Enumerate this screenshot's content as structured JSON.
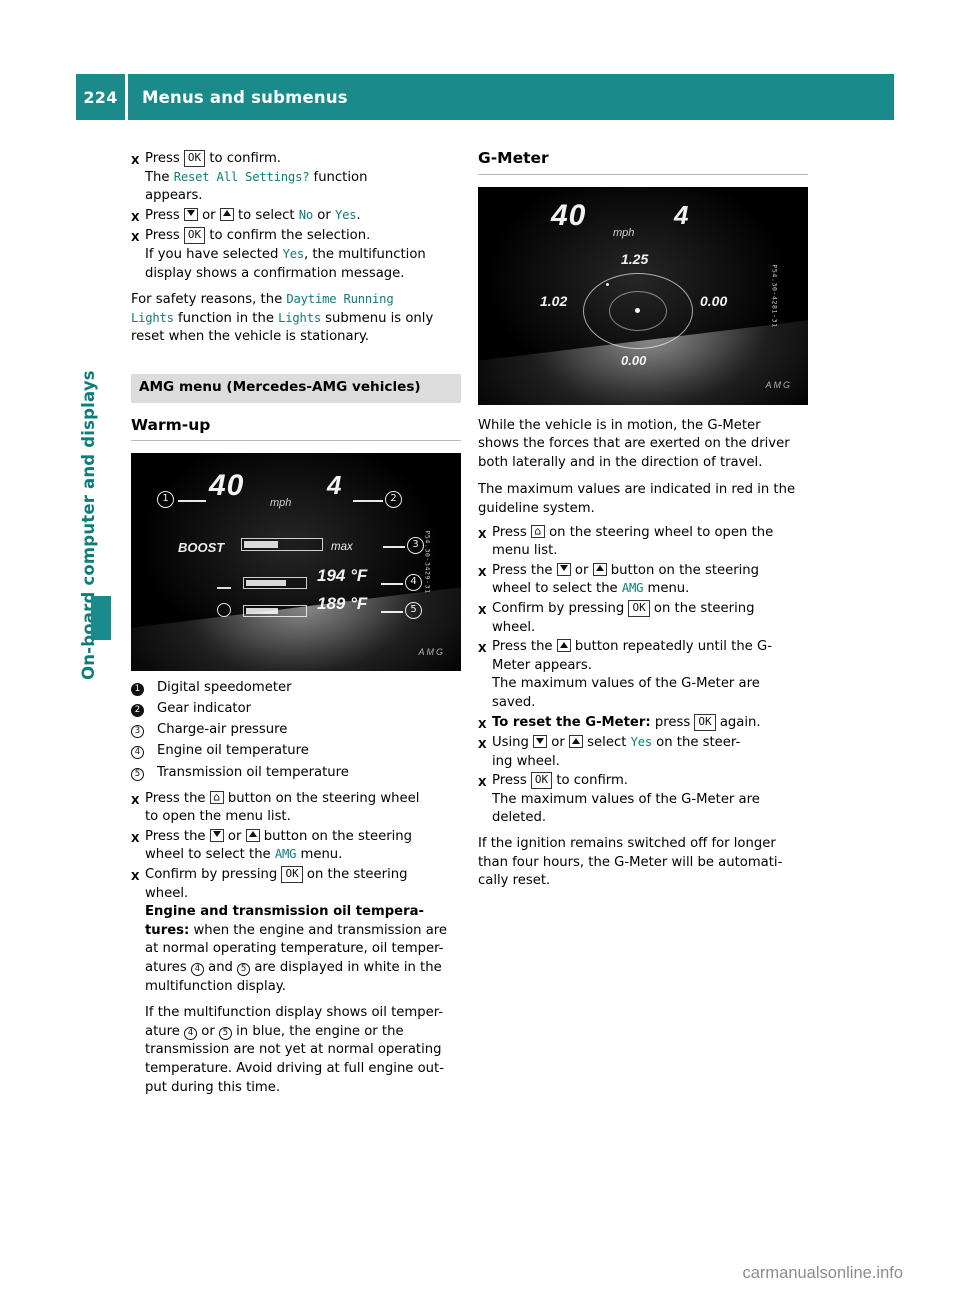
{
  "header": {
    "page_number": "224",
    "title": "Menus and submenus",
    "accent_color": "#1b8a8a"
  },
  "sidebar": {
    "chapter_label": "On-board computer and displays"
  },
  "left_column": {
    "steps": [
      {
        "pre": "Press ",
        "key": "OK",
        "post": " to confirm."
      },
      {
        "pre": "Press ",
        "key": "",
        "post": ""
      }
    ],
    "block1": {
      "line1_pre": "Press ",
      "line1_key": "OK",
      "line1_post": " to confirm.",
      "line2_pre": "The ",
      "line2_mono": "Reset All Settings?",
      "line2_post": " function",
      "line3": "appears."
    },
    "block2": {
      "pre": "Press ",
      "mid": " or ",
      "post": " to select ",
      "option_no": "No",
      "or": " or ",
      "option_yes": "Yes",
      "end": "."
    },
    "block3": {
      "line1_pre": "Press ",
      "line1_key": "OK",
      "line1_post": " to confirm the selection.",
      "line2_pre": "If you have selected ",
      "line2_mono": "Yes",
      "line2_post": ", the multifunction",
      "line3": "display shows a confirmation message."
    },
    "safety_note": {
      "pre": "For safety reasons, the ",
      "mono1": "Daytime Running",
      "mono1b": "Lights",
      "mid": " function in the ",
      "mono2": "Lights",
      "post": " submenu is only",
      "last": "reset when the vehicle is stationary."
    },
    "section_heading": "AMG menu (Mercedes-AMG vehicles)",
    "subheading": "Warm-up",
    "warmup_display": {
      "speed": "40",
      "speed_unit": "mph",
      "gear": "4",
      "boost_label": "BOOST",
      "max_label": "max",
      "engine_oil_temp": "194 °F",
      "transmission_oil_temp": "189 °F",
      "callouts": [
        "1",
        "2",
        "3",
        "4",
        "5"
      ],
      "watermark": "AMG",
      "side_code": "P54.30-3429-31"
    },
    "legend": [
      {
        "key": "1",
        "text": "Digital speedometer"
      },
      {
        "key": "2",
        "text": "Gear indicator"
      },
      {
        "key": "3",
        "text": "Charge-air pressure"
      },
      {
        "key": "4",
        "text": "Engine oil temperature"
      },
      {
        "key": "5",
        "text": "Transmission oil temperature"
      }
    ],
    "steps_after": {
      "s1_a": "Press the ",
      "s1_b": " button on the steering wheel",
      "s1_c": "to open the menu list.",
      "s2_a": "Press the ",
      "s2_or": " or ",
      "s2_b": " button on the steering",
      "s2_c": "wheel to select the ",
      "s2_mono": "AMG",
      "s2_d": " menu.",
      "s3_a": "Confirm by pressing ",
      "s3_key": "OK",
      "s3_b": " on the steering",
      "s3_c": "wheel.",
      "bold1": "Engine and transmission oil tempera-",
      "bold2": "tures:",
      "t1": " when the engine and transmission are",
      "t2": "at normal operating temperature, oil temper-",
      "t3_pre": "atures ",
      "t3_and": " and ",
      "t3_post": " are displayed in white in the",
      "t4": "multifunction display.",
      "p2_1": "If the multifunction display shows oil temper-",
      "p2_2_pre": "ature ",
      "p2_2_or": " or ",
      "p2_2_post": " in blue, the engine or the",
      "p2_3": "transmission are not yet at normal operating",
      "p2_4": "temperature. Avoid driving at full engine out-",
      "p2_5": "put during this time."
    }
  },
  "right_column": {
    "subheading": "G-Meter",
    "gmeter_display": {
      "speed": "40",
      "speed_unit": "mph",
      "gear": "4",
      "value_top": "1.25",
      "value_left": "1.02",
      "value_right": "0.00",
      "value_bottom": "0.00",
      "watermark": "AMG",
      "side_code": "P54.30-4281-31"
    },
    "para1": [
      "While the vehicle is in motion, the G-Meter",
      "shows the forces that are exerted on the driver",
      "both laterally and in the direction of travel."
    ],
    "para2": [
      "The maximum values are indicated in red in the",
      "guideline system."
    ],
    "steps": {
      "s1_a": "Press ",
      "s1_b": " on the steering wheel to open the",
      "s1_c": "menu list.",
      "s2_a": "Press the ",
      "s2_or": " or ",
      "s2_b": " button on the steering",
      "s2_c": "wheel to select the ",
      "s2_mono": "AMG",
      "s2_d": " menu.",
      "s3_a": "Confirm by pressing ",
      "s3_key": "OK",
      "s3_b": " on the steering",
      "s3_c": "wheel.",
      "s4_a": "Press the ",
      "s4_b": " button repeatedly until the G-",
      "s4_c": "Meter appears.",
      "s4_d": "The maximum values of the G-Meter are",
      "s4_e": "saved.",
      "s5_bold": "To reset the G-Meter:",
      "s5_a": " press ",
      "s5_key": "OK",
      "s5_b": " again.",
      "s6_a": "Using ",
      "s6_or": " or ",
      "s6_b": " select ",
      "s6_mono": "Yes",
      "s6_c": " on the steer-",
      "s6_d": "ing wheel.",
      "s7_a": "Press ",
      "s7_key": "OK",
      "s7_b": " to confirm.",
      "s7_c": "The maximum values of the G-Meter are",
      "s7_d": "deleted."
    },
    "para3": [
      "If the ignition remains switched off for longer",
      "than four hours, the G-Meter will be automati-",
      "cally reset."
    ]
  },
  "footer": {
    "watermark_main": "carmanualsonline",
    "watermark_suffix": ".info"
  }
}
